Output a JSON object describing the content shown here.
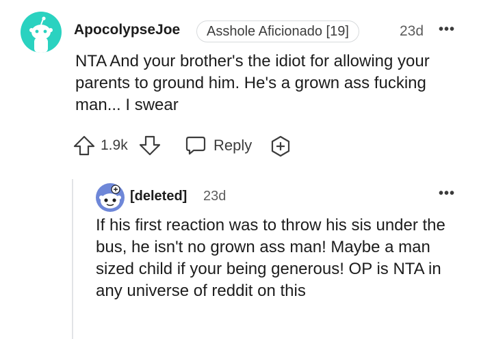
{
  "top_comment": {
    "author": "ApocolypseJoe",
    "flair": "Asshole Aficionado [19]",
    "time": "23d",
    "more": "•••",
    "body": "NTA And your brother's the idiot for allowing your parents to ground him. He's a grown ass fucking man... I swear",
    "score": "1.9k",
    "reply_label": "Reply",
    "avatar_color": "#2ad2c0"
  },
  "reply_comment": {
    "author": "[deleted]",
    "time": "23d",
    "more": "•••",
    "body": "If his first reaction was to throw his sis under the bus, he isn't no grown ass man! Maybe a man sized child if your being generous! OP is NTA in any universe of reddit on this",
    "avatar_color": "#6e87d8"
  },
  "icons": {
    "upvote": "upvote-arrow-icon",
    "downvote": "downvote-arrow-icon",
    "reply": "speech-bubble-icon",
    "award": "award-plus-icon",
    "more": "more-dots-icon"
  }
}
